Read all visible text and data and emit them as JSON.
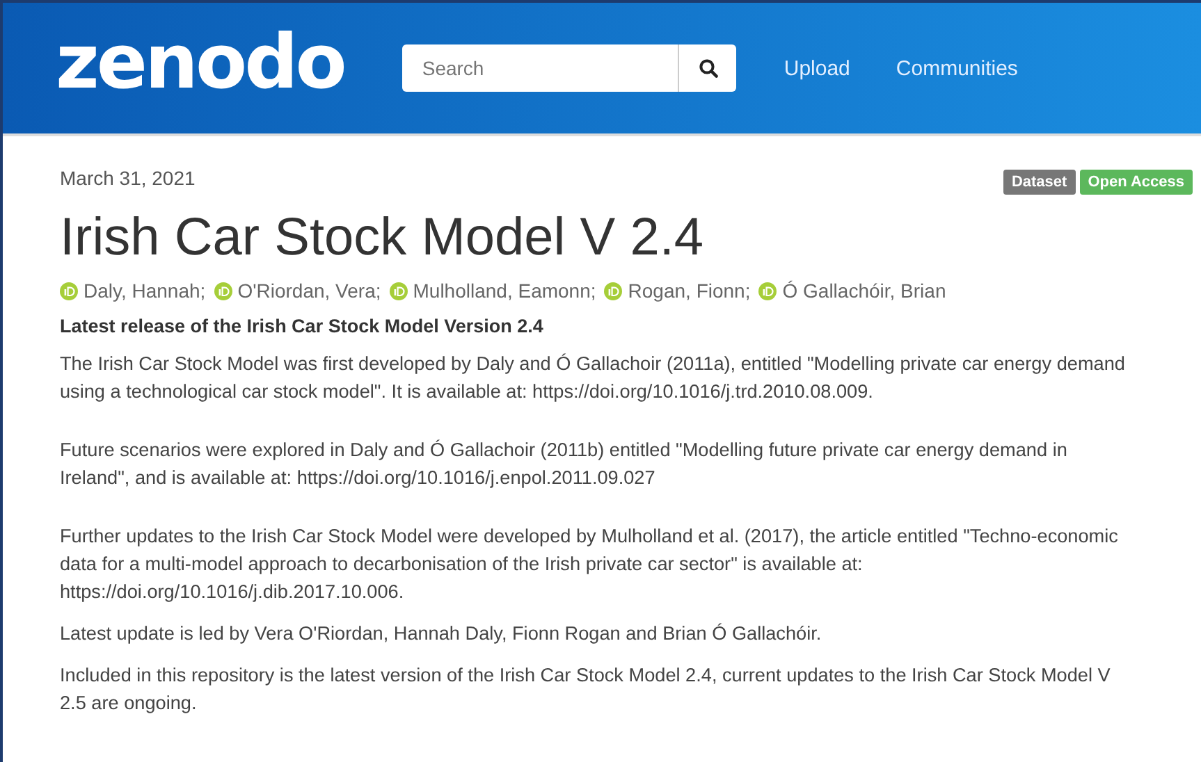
{
  "header": {
    "logo": "zenodo",
    "search": {
      "placeholder": "Search"
    },
    "nav": [
      "Upload",
      "Communities"
    ]
  },
  "record": {
    "date": "March 31, 2021",
    "badges": [
      {
        "label": "Dataset",
        "color": "#777777"
      },
      {
        "label": "Open Access",
        "color": "#5cb85c"
      }
    ],
    "title": "Irish Car Stock Model V 2.4",
    "authors": [
      "Daly, Hannah;",
      "O'Riordan, Vera;",
      "Mulholland, Eamonn;",
      "Rogan, Fionn;",
      "Ó Gallachóir, Brian"
    ],
    "subtitle": "Latest release of the Irish Car Stock Model Version 2.4",
    "references": [
      "The Irish Car Stock Model was first developed by Daly and Ó Gallachoir (2011a), entitled \"Modelling private car energy demand using a technological car stock model\". It is available at: https://doi.org/10.1016/j.trd.2010.08.009.",
      "Future scenarios were explored in Daly and Ó Gallachoir (2011b) entitled \"Modelling future private car energy demand in Ireland\", and is available at: https://doi.org/10.1016/j.enpol.2011.09.027",
      "Further updates to the Irish Car Stock Model were developed by Mulholland et al. (2017), the article entitled \"Techno-economic data for a multi-model approach to decarbonisation of the Irish private car sector\" is available at: https://doi.org/10.1016/j.dib.2017.10.006."
    ],
    "notes": [
      "Latest update is led by Vera O'Riordan, Hannah Daly, Fionn Rogan and Brian Ó Gallachóir.",
      "Included in this repository is the latest version of the Irish Car Stock Model 2.4, current updates to the Irish Car Stock Model V 2.5 are ongoing."
    ]
  }
}
